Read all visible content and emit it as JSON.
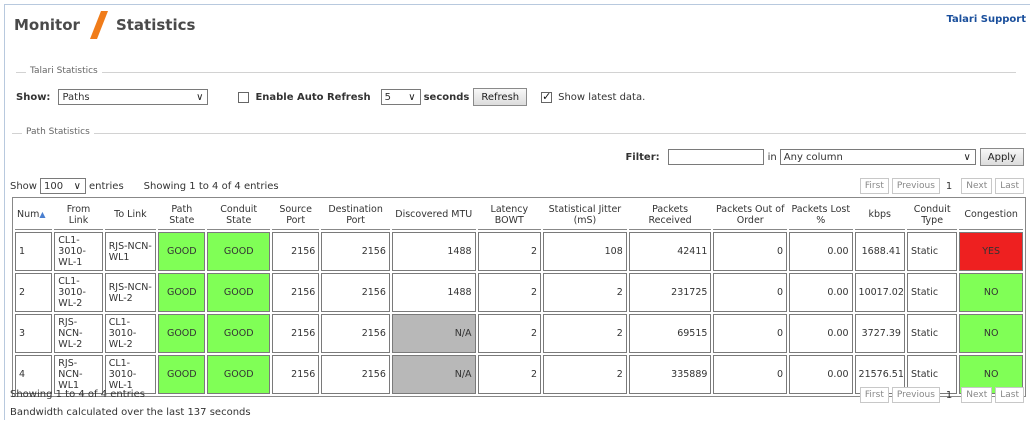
{
  "header": {
    "crumb_monitor": "Monitor",
    "crumb_statistics": "Statistics",
    "support_link": "Talari Support",
    "accent_color": "#f07c1a"
  },
  "talari_stats": {
    "legend": "Talari Statistics",
    "show_label": "Show:",
    "show_value": "Paths",
    "auto_refresh_label": "Enable Auto Refresh",
    "auto_refresh_checked": false,
    "seconds_value": "5",
    "seconds_label": "seconds",
    "refresh_button": "Refresh",
    "show_latest_label": "Show latest data.",
    "show_latest_checked": true
  },
  "path_stats": {
    "legend": "Path Statistics",
    "filter_label": "Filter:",
    "filter_value": "",
    "in_label": "in",
    "column_value": "Any column",
    "apply_button": "Apply",
    "show_label": "Show",
    "entries_value": "100",
    "entries_label": "entries",
    "showing_text": "Showing 1 to 4 of 4 entries",
    "pager": {
      "first": "First",
      "previous": "Previous",
      "page": "1",
      "next": "Next",
      "last": "Last"
    },
    "columns": [
      "Num",
      "From Link",
      "To Link",
      "Path State",
      "Conduit State",
      "Source Port",
      "Destination Port",
      "Discovered MTU",
      "Latency BOWT",
      "Statistical Jitter (mS)",
      "Packets Received",
      "Packets Out of Order",
      "Packets Lost %",
      "kbps",
      "Conduit Type",
      "Congestion"
    ],
    "rows": [
      [
        "1",
        "CL1-3010-WL-1",
        "RJS-NCN-WL1",
        "GOOD",
        "GOOD",
        "2156",
        "2156",
        "1488",
        "2",
        "108",
        "42411",
        "0",
        "0.00",
        "1688.41",
        "Static",
        "YES"
      ],
      [
        "2",
        "CL1-3010-WL-2",
        "RJS-NCN-WL-2",
        "GOOD",
        "GOOD",
        "2156",
        "2156",
        "1488",
        "2",
        "2",
        "231725",
        "0",
        "0.00",
        "10017.02",
        "Static",
        "NO"
      ],
      [
        "3",
        "RJS-NCN-WL-2",
        "CL1-3010-WL-2",
        "GOOD",
        "GOOD",
        "2156",
        "2156",
        "N/A",
        "2",
        "2",
        "69515",
        "0",
        "0.00",
        "3727.39",
        "Static",
        "NO"
      ],
      [
        "4",
        "RJS-NCN-WL1",
        "CL1-3010-WL-1",
        "GOOD",
        "GOOD",
        "2156",
        "2156",
        "N/A",
        "2",
        "2",
        "335889",
        "0",
        "0.00",
        "21576.51",
        "Static",
        "NO"
      ]
    ],
    "footer_showing": "Showing 1 to 4 of 4 entries",
    "bandwidth_note": "Bandwidth calculated over the last 137 seconds"
  }
}
